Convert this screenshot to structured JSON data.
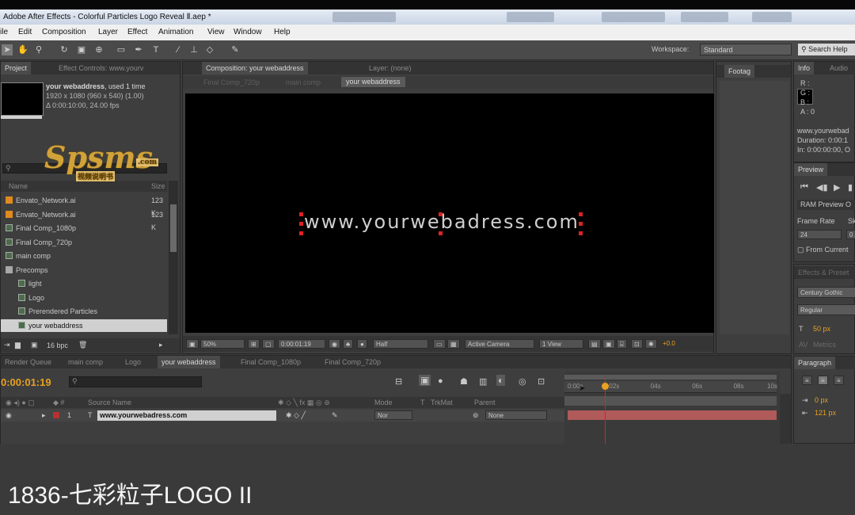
{
  "window": {
    "title": "Adobe After Effects - Colorful Particles Logo Reveal Ⅱ.aep *"
  },
  "menu": [
    "ile",
    "Edit",
    "Composition",
    "Layer",
    "Effect",
    "Animation",
    "View",
    "Window",
    "Help"
  ],
  "toolbar": {
    "workspace_label": "Workspace:",
    "workspace_value": "Standard",
    "search_placeholder": "Search Help"
  },
  "project_panel": {
    "tab_project": "Project",
    "tab_effect_controls": "Effect Controls: www.yourv",
    "comp_name": "your webaddress",
    "used": ", used 1 time",
    "dimensions": "1920 x 1080  (960 x 540) (1.00)",
    "duration": "Δ 0:00:10:00, 24.00 fps",
    "col_name": "Name",
    "col_size": "Size",
    "items": [
      {
        "name": "Envato_Network.ai",
        "size": "123 K",
        "type": "ai",
        "indent": 0
      },
      {
        "name": "Envato_Network.ai",
        "size": "123 K",
        "type": "ai",
        "indent": 0
      },
      {
        "name": "Final Comp_1080p",
        "size": "",
        "type": "comp",
        "indent": 0
      },
      {
        "name": "Final Comp_720p",
        "size": "",
        "type": "comp",
        "indent": 0
      },
      {
        "name": "main comp",
        "size": "",
        "type": "comp",
        "indent": 0
      },
      {
        "name": "Precomps",
        "size": "",
        "type": "folder",
        "indent": 0
      },
      {
        "name": "light",
        "size": "",
        "type": "comp",
        "indent": 1
      },
      {
        "name": "Logo",
        "size": "",
        "type": "comp",
        "indent": 1
      },
      {
        "name": "Prerendered Particles",
        "size": "",
        "type": "comp",
        "indent": 1
      },
      {
        "name": "your webaddress",
        "size": "",
        "type": "comp",
        "indent": 1,
        "selected": true
      }
    ],
    "bpc": "16 bpc"
  },
  "comp_panel": {
    "tab_comp": "Composition: your webaddress",
    "tab_layer": "Layer: (none)",
    "breadcrumbs": [
      "Final Comp_720p",
      "main comp",
      "your webaddress"
    ],
    "canvas_text": "www.yourwebadress.com",
    "zoom": "50%",
    "timecode": "0:00:01:19",
    "resolution": "Half",
    "camera": "Active Camera",
    "view": "1 View",
    "exposure": "+0.0"
  },
  "footage_tab": "Footag",
  "info_panel": {
    "tab_info": "Info",
    "tab_audio": "Audio",
    "r": "R :",
    "g": "G :",
    "b": "B :",
    "a": "A : 0",
    "line1": "www.yourwebad",
    "line2": "Duration: 0:00:1",
    "line3": "In: 0:00:00:00, O"
  },
  "preview_panel": {
    "title": "Preview",
    "ram_preview": "RAM Preview O",
    "frame_rate_label": "Frame Rate",
    "skip_label": "Sk",
    "frame_rate_value": "24",
    "skip_value": "0",
    "from_current": "From Current"
  },
  "effects_panel": {
    "title": "Effects & Preset",
    "font": "Century Gothic",
    "style": "Regular",
    "size": "50 px",
    "metrics": "Metrics"
  },
  "paragraph_panel": {
    "title": "Paragraph",
    "val1": "0 px",
    "val2": "121 px"
  },
  "timeline": {
    "tabs": [
      "Render Queue",
      "main comp",
      "Logo",
      "your webaddress",
      "Final Comp_1080p",
      "Final Comp_720p"
    ],
    "active_tab_index": 3,
    "current_time": "0:00:01:19",
    "col_source_name": "Source Name",
    "col_mode": "Mode",
    "col_t": "T",
    "col_trkmat": "TrkMat",
    "col_parent": "Parent",
    "layer_number": "1",
    "layer_name": "www.yourwebadress.com",
    "layer_mode": "Nor",
    "layer_parent": "None",
    "ruler_labels": [
      "0:00s",
      "02s",
      "04s",
      "06s",
      "08s",
      "10s"
    ],
    "playhead_seconds": 1.79,
    "duration_seconds": 10
  },
  "watermark": {
    "main": "Spsms",
    "dotcom": ".com",
    "sub": "视频说明书"
  },
  "caption": "1836-七彩粒子LOGO II",
  "colors": {
    "accent": "#e8a020",
    "layer_bar": "#b05a5a",
    "playhead": "#e02020"
  }
}
